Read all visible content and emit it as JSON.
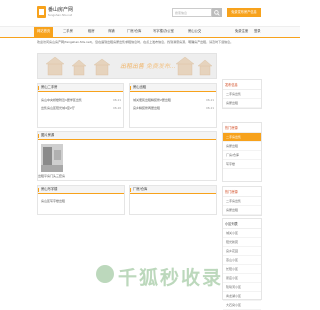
{
  "header": {
    "logo_title": "番山房产网",
    "logo_url": "fangshan.fzls.net",
    "search_placeholder": "搜索信息",
    "publish_label": "免费发布房产信息"
  },
  "nav": [
    "网站首页",
    "二手房",
    "租房",
    "商铺",
    "厂房/仓库",
    "写字楼/办公室",
    "房山公交"
  ],
  "nav_right": [
    "免费注册",
    "登录"
  ],
  "notice": "欢迎访问房山房产网(fangshan.fzls.net)，您在遇到出租房屋出售求租信息时，在点上发布信息，找到满意房源，明确房产出租，请及时下载信息。",
  "banner": {
    "text1": "出租出售",
    "text2": "免费发布..."
  },
  "panels": {
    "house": {
      "title": "房山二手房",
      "items": [
        {
          "text": "房山中央桥楼附近1居学区出售",
          "date": "08-21"
        },
        {
          "text": "出售房山区阳光城4室2厅",
          "date": "08-20"
        }
      ]
    },
    "rent": {
      "title": "房山出租",
      "items": [
        {
          "text": "城关便民出租精装修2居出租",
          "date": "08-21"
        },
        {
          "text": "良乡精装修两居出租",
          "date": "08-21"
        }
      ]
    },
    "photo": {
      "title": "图片房源",
      "caption": "出租平房门头三套房"
    },
    "office": {
      "title": "房山写字楼",
      "items": [
        {
          "text": "房山区写字楼出租",
          "date": ""
        }
      ]
    },
    "factory": {
      "title": "厂房/仓库"
    }
  },
  "sidebar": {
    "block1": {
      "title": "发布信息",
      "items": [
        "二手房出售",
        "房屋出租"
      ]
    },
    "block2": {
      "title": "热门房源",
      "items": [
        "二手房出售",
        "房屋出租",
        "厂房/仓库",
        "写字楼"
      ]
    },
    "block3": {
      "title": "热门房源",
      "items": [
        "二手房出售",
        "房屋出租"
      ]
    },
    "block4": {
      "title": "小区列表",
      "items": [
        "城关小区",
        "阳光新苑",
        "良乡花园",
        "燕山小区",
        "长阳小区",
        "窦店小区",
        "琉璃河小区",
        "青龙湖小区",
        "大石窝小区"
      ]
    }
  },
  "watermark": "千狐秒收录"
}
